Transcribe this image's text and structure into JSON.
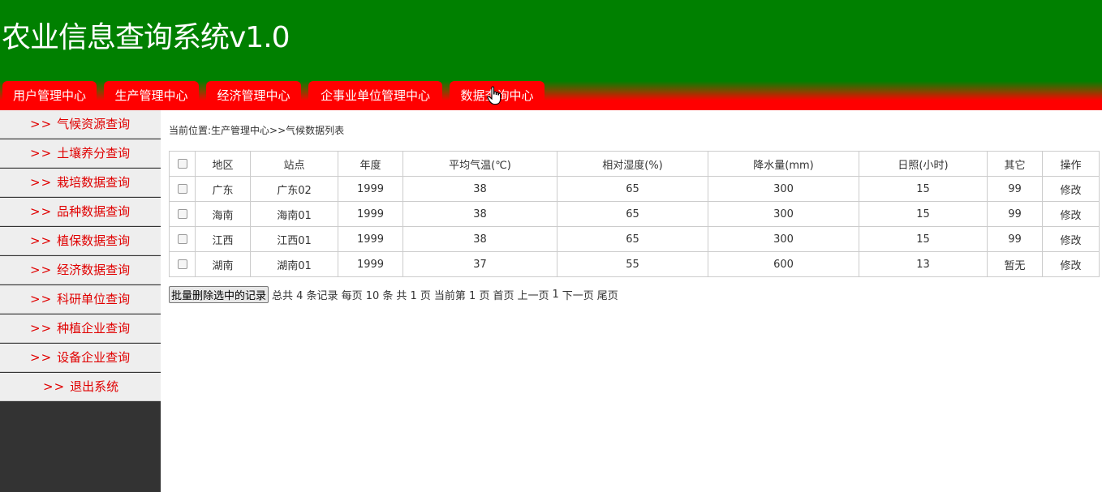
{
  "header": {
    "title": "农业信息查询系统v1.0",
    "tabs": [
      {
        "label": "用户管理中心"
      },
      {
        "label": "生产管理中心"
      },
      {
        "label": "经济管理中心"
      },
      {
        "label": "企事业单位管理中心"
      },
      {
        "label": "数据查询中心"
      }
    ]
  },
  "sidebar": {
    "arrow": ">>",
    "items": [
      {
        "label": "气候资源查询"
      },
      {
        "label": "土壤养分查询"
      },
      {
        "label": "栽培数据查询"
      },
      {
        "label": "品种数据查询"
      },
      {
        "label": "植保数据查询"
      },
      {
        "label": "经济数据查询"
      },
      {
        "label": "科研单位查询"
      },
      {
        "label": "种植企业查询"
      },
      {
        "label": "设备企业查询"
      },
      {
        "label": "退出系统"
      }
    ]
  },
  "breadcrumb": "当前位置:生产管理中心>>气候数据列表",
  "table": {
    "headers": [
      "地区",
      "站点",
      "年度",
      "平均气温(℃)",
      "相对湿度(%)",
      "降水量(mm)",
      "日照(小时)",
      "其它",
      "操作"
    ],
    "rows": [
      [
        "广东",
        "广东02",
        "1999",
        "38",
        "65",
        "300",
        "15",
        "99",
        "修改"
      ],
      [
        "海南",
        "海南01",
        "1999",
        "38",
        "65",
        "300",
        "15",
        "99",
        "修改"
      ],
      [
        "江西",
        "江西01",
        "1999",
        "38",
        "65",
        "300",
        "15",
        "99",
        "修改"
      ],
      [
        "湖南",
        "湖南01",
        "1999",
        "37",
        "55",
        "600",
        "13",
        "暂无",
        "修改"
      ]
    ]
  },
  "pager": {
    "batch_delete": "批量删除选中的记录",
    "total": "总共 4 条记录",
    "per_page": "每页 10 条",
    "pages": "共 1 页",
    "current": "当前第 1 页",
    "first": "首页",
    "prev": "上一页",
    "page_num": "1",
    "next": "下一页",
    "last": "尾页"
  },
  "colors": {
    "header_green": "#008000",
    "tab_red": "#ff0000",
    "sidebar_text": "#e00000",
    "sidebar_bg": "#333333"
  }
}
